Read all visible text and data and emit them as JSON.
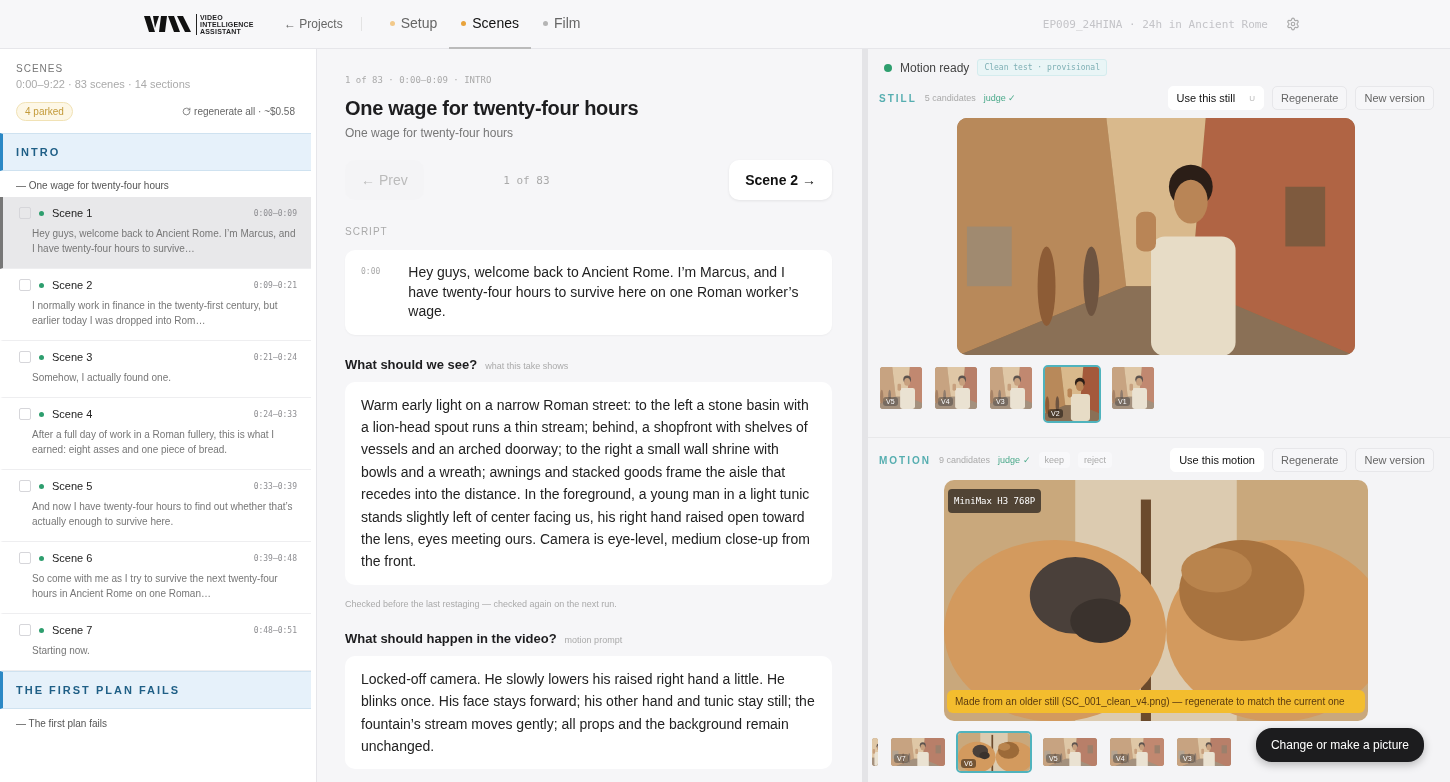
{
  "header": {
    "brand": "VIDEO INTELLIGENCE ASSISTANT",
    "back_link": "← Projects",
    "tabs": [
      {
        "label": "Setup",
        "selected": false,
        "color": "#f2c98a"
      },
      {
        "label": "Scenes",
        "selected": true,
        "color": "#e8a33c"
      },
      {
        "label": "Film",
        "selected": false,
        "color": "#b5b5b5"
      }
    ],
    "project": "EP009_24HINA · 24h in Ancient Rome"
  },
  "sidebar": {
    "title": "SCENES",
    "summary": "0:00–9:22 · 83 scenes · 14 sections",
    "parked": "4 parked",
    "regenerate_all": "regenerate all · ~$0.58",
    "sections": [
      {
        "title": "INTRO",
        "subtitle": "— One wage for twenty-four hours",
        "scenes": [
          {
            "title": "Scene 1",
            "time": "0:00–0:09",
            "excerpt": "Hey guys, welcome back to Ancient Rome. I’m Marcus, and I have twenty-four hours to survive…",
            "selected": true,
            "checked": false,
            "color": "#2e9e6e"
          },
          {
            "title": "Scene 2",
            "time": "0:09–0:21",
            "excerpt": "I normally work in finance in the twenty-first century, but earlier today I was dropped into Rom…",
            "selected": false,
            "checked": false,
            "color": "#2e9e6e"
          },
          {
            "title": "Scene 3",
            "time": "0:21–0:24",
            "excerpt": "Somehow, I actually found one.",
            "selected": false,
            "checked": false,
            "color": "#2e9e6e"
          },
          {
            "title": "Scene 4",
            "time": "0:24–0:33",
            "excerpt": "After a full day of work in a Roman fullery, this is what I earned: eight asses and one piece of bread.",
            "selected": false,
            "checked": false,
            "color": "#2e9e6e"
          },
          {
            "title": "Scene 5",
            "time": "0:33–0:39",
            "excerpt": "And now I have twenty-four hours to find out whether that’s actually enough to survive here.",
            "selected": false,
            "checked": false,
            "color": "#2e9e6e"
          },
          {
            "title": "Scene 6",
            "time": "0:39–0:48",
            "excerpt": "So come with me as I try to survive the next twenty-four hours in Ancient Rome on one Roman…",
            "selected": false,
            "checked": false,
            "color": "#2e9e6e"
          },
          {
            "title": "Scene 7",
            "time": "0:48–0:51",
            "excerpt": "Starting now.",
            "selected": false,
            "checked": false,
            "color": "#2e9e6e"
          }
        ]
      },
      {
        "title": "THE FIRST PLAN FAILS",
        "subtitle": "— The first plan fails"
      }
    ]
  },
  "scene": {
    "meta": "1 of 83 · 0:00–0:09 · INTRO",
    "title": "One wage for twenty-four hours",
    "subtitle": "One wage for twenty-four hours",
    "prev": {
      "label": "← Prev",
      "disabled": true
    },
    "position": "1 of 83",
    "next": {
      "label": "Scene 2 →",
      "disabled": false
    },
    "script_label": "SCRIPT",
    "script": {
      "time": "0:00",
      "text": "Hey guys, welcome back to Ancient Rome. I’m Marcus, and I have twenty-four hours to survive here on one Roman worker’s wage."
    },
    "see": {
      "heading": "What should we see?",
      "hint": "what this take shows",
      "text": "Warm early light on a narrow Roman street: to the left a stone basin with a lion-head spout runs a thin stream; behind, a shopfront with shelves of vessels and an arched doorway; to the right a small wall shrine with bowls and a wreath; awnings and stacked goods frame the aisle that recedes into the distance. In the foreground, a young man in a light tunic stands slightly left of center facing us, his right hand raised open toward the lens, eyes meeting ours. Camera is eye-level, medium close-up from the front.",
      "note": "Checked before the last restaging — checked again on the next run."
    },
    "motion": {
      "heading": "What should happen in the video?",
      "hint": "motion prompt",
      "text": "Locked-off camera. He slowly lowers his raised right hand a little. He blinks once. His face stays forward; his other hand and tunic stay still; the fountain’s stream moves gently; all props and the background remain unchanged."
    }
  },
  "preview": {
    "status": "Motion ready",
    "badge": "Clean test · provisional",
    "still": {
      "label": "STILL",
      "candidates": "5 candidates",
      "judge": "judge ✓",
      "use": "Use this still",
      "shortcut": "U",
      "regenerate": "Regenerate",
      "new_version": "New version",
      "thumbs": [
        {
          "label": "V5",
          "selected": false
        },
        {
          "label": "V4",
          "selected": false
        },
        {
          "label": "V3",
          "selected": false
        },
        {
          "label": "V2",
          "selected": true
        },
        {
          "label": "V1",
          "selected": false
        }
      ]
    },
    "motion": {
      "label": "MOTION",
      "candidates": "9 candidates",
      "judge": "judge ✓",
      "keep": "keep",
      "reject": "reject",
      "use": "Use this motion",
      "regenerate": "Regenerate",
      "new_version": "New version",
      "model": "MiniMax H3 768P",
      "warning": "Made from an older still (SC_001_clean_v4.png) — regenerate to match the current one",
      "thumbs": [
        {
          "selected": false
        },
        {
          "label": "V7",
          "selected": false
        },
        {
          "label": "V6",
          "selected": true
        },
        {
          "label": "V5",
          "selected": false
        },
        {
          "label": "V4",
          "selected": false
        },
        {
          "label": "V3",
          "selected": false
        }
      ]
    },
    "fab": "Change or make a picture"
  }
}
